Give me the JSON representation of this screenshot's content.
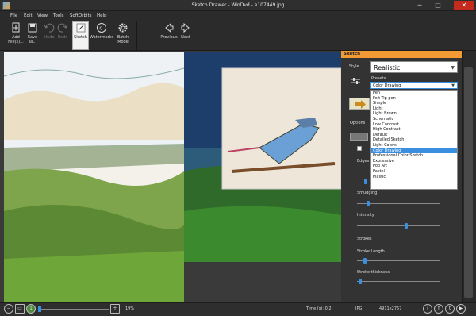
{
  "window": {
    "title": "Sketch Drawer - WinDvd - e107449.jpg",
    "minimize": "─",
    "maximize": "□",
    "close": "✕"
  },
  "menu": [
    "File",
    "Edit",
    "View",
    "Tools",
    "SoftOrbits",
    "Help"
  ],
  "toolbar": {
    "add": "Add File(s)...",
    "save": "Save as...",
    "undo": "Undo",
    "redo": "Redo",
    "sketch": "Sketch",
    "watermarks": "Watermarks",
    "batch": "Batch Mode",
    "previous": "Previous",
    "next": "Next"
  },
  "panel": {
    "header": "Sketch",
    "style_label": "Style",
    "style_value": "Realistic",
    "presets_label": "Presets",
    "presets_value": "Color Drawing",
    "presets": [
      "Pen",
      "Felt-Tip pen",
      "Simple",
      "Light",
      "Light Brown",
      "Schematic",
      "Low Contrast",
      "High Contrast",
      "Default",
      "Detailed Sketch",
      "Light Colors",
      "Color Drawing",
      "Professional Color Sketch",
      "Expressive",
      "Pop Art",
      "Pastel",
      "Plastic"
    ],
    "selected_preset_index": 11,
    "options_label": "Options",
    "edges_label": "Edges",
    "smudging_label": "Smudging",
    "intensity_label": "Intensity",
    "strokes_label": "Strokes",
    "stroke_length_label": "Stroke Length",
    "stroke_thickness_label": "Stroke thickness",
    "smudging_value": 0.12,
    "intensity_value": 0.6,
    "stroke_length_value": 0.08,
    "stroke_thickness_value": 0.02
  },
  "status": {
    "zoom": "19%",
    "time": "Time (s): 0.2",
    "format": "JPG",
    "dimensions": "4911x2757"
  },
  "colors": {
    "accent": "#f29a33",
    "selection": "#3b8fe0"
  }
}
